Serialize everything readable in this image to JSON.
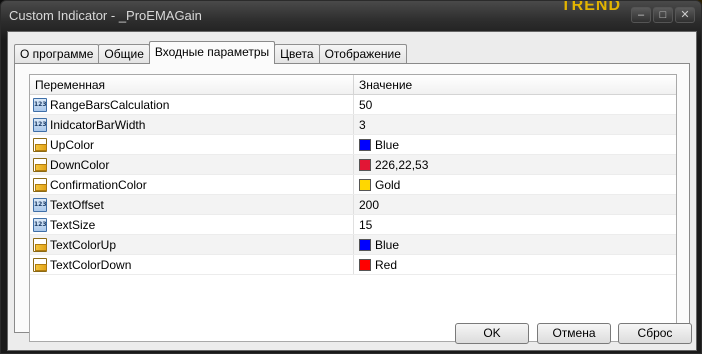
{
  "window": {
    "title": "Custom Indicator - _ProEMAGain",
    "brand": "TREND",
    "controls": [
      "–",
      "□",
      "✕"
    ]
  },
  "tabs": [
    {
      "label": "О программе",
      "active": false
    },
    {
      "label": "Общие",
      "active": false
    },
    {
      "label": "Входные параметры",
      "active": true
    },
    {
      "label": "Цвета",
      "active": false
    },
    {
      "label": "Отображение",
      "active": false
    }
  ],
  "grid": {
    "headers": {
      "name": "Переменная",
      "value": "Значение"
    },
    "rows": [
      {
        "type": "int",
        "icon": "int-param-icon",
        "name": "RangeBarsCalculation",
        "value": "50"
      },
      {
        "type": "int",
        "icon": "int-param-icon",
        "name": "InidcatorBarWidth",
        "value": "3"
      },
      {
        "type": "color",
        "icon": "color-param-icon",
        "name": "UpColor",
        "value": "Blue",
        "swatch": "#0000ff"
      },
      {
        "type": "color",
        "icon": "color-param-icon",
        "name": "DownColor",
        "value": "226,22,53",
        "swatch": "#e21635"
      },
      {
        "type": "color",
        "icon": "color-param-icon",
        "name": "ConfirmationColor",
        "value": "Gold",
        "swatch": "#ffd700"
      },
      {
        "type": "int",
        "icon": "int-param-icon",
        "name": "TextOffset",
        "value": "200"
      },
      {
        "type": "int",
        "icon": "int-param-icon",
        "name": "TextSize",
        "value": "15"
      },
      {
        "type": "color",
        "icon": "color-param-icon",
        "name": "TextColorUp",
        "value": "Blue",
        "swatch": "#0000ff"
      },
      {
        "type": "color",
        "icon": "color-param-icon",
        "name": "TextColorDown",
        "value": "Red",
        "swatch": "#ff0000"
      }
    ]
  },
  "buttons": {
    "ok": "OK",
    "cancel": "Отмена",
    "reset": "Сброс"
  }
}
